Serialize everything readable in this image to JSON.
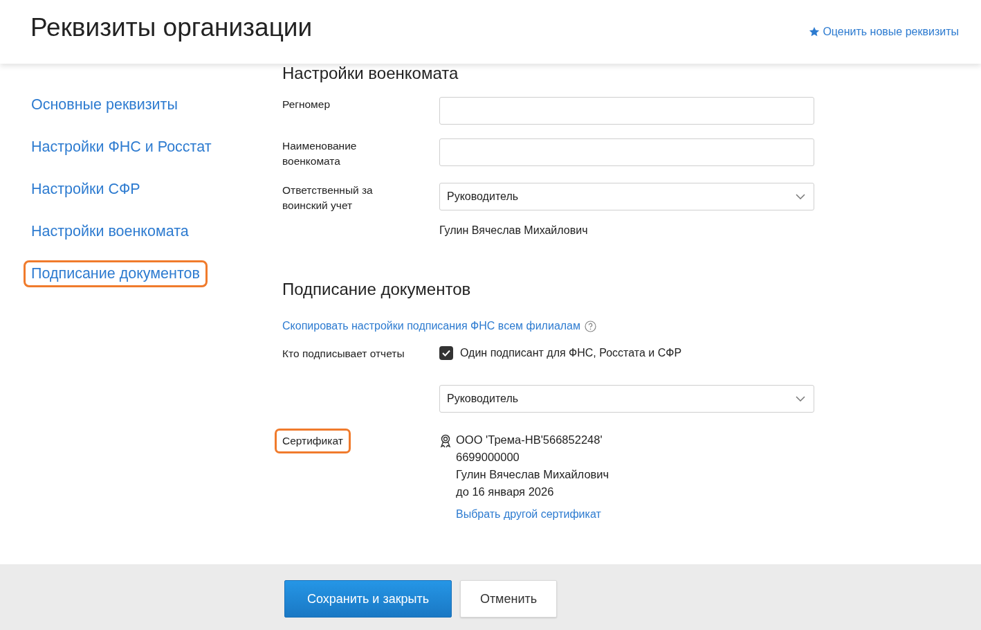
{
  "header": {
    "title": "Реквизиты организации",
    "rate_link": "Оценить новые реквизиты"
  },
  "sidebar": {
    "items": [
      {
        "label": "Основные реквизиты",
        "highlighted": false
      },
      {
        "label": "Настройки ФНС и Росстат",
        "highlighted": false
      },
      {
        "label": "Настройки СФР",
        "highlighted": false
      },
      {
        "label": "Настройки военкомата",
        "highlighted": false
      },
      {
        "label": "Подписание документов",
        "highlighted": true
      }
    ]
  },
  "sections": [
    {
      "title": "Настройки военкомата",
      "rows": [
        {
          "kind": "input",
          "label": "Регномер"
        },
        {
          "kind": "input",
          "label": "Наименование\nвоенкомата"
        },
        {
          "kind": "select",
          "label": "Ответственный за\nвоинский учет",
          "value": "Руководитель",
          "note": "Гулин Вячеслав Михайлович"
        }
      ]
    },
    {
      "title": "Подписание документов",
      "link": "Скопировать настройки подписания ФНС всем филиалам",
      "rows": [
        {
          "kind": "checkbox",
          "label": "Кто подписывает отчеты",
          "text": "Один подписант для ФНС, Росстата и СФР",
          "checked": true
        },
        {
          "kind": "select",
          "value": "Руководитель"
        },
        {
          "kind": "certificate",
          "label": "Сертификат",
          "highlighted": true,
          "lines": [
            "ООО 'Трема-НВ'566852248'",
            "6699000000",
            "Гулин Вячеслав Михайлович",
            "до 16 января 2026"
          ],
          "link": "Выбрать другой сертификат"
        }
      ]
    }
  ],
  "footer": {
    "buttons": [
      {
        "label": "Сохранить и закрыть",
        "kind": "primary"
      },
      {
        "label": "Отменить",
        "kind": "secondary"
      }
    ]
  }
}
